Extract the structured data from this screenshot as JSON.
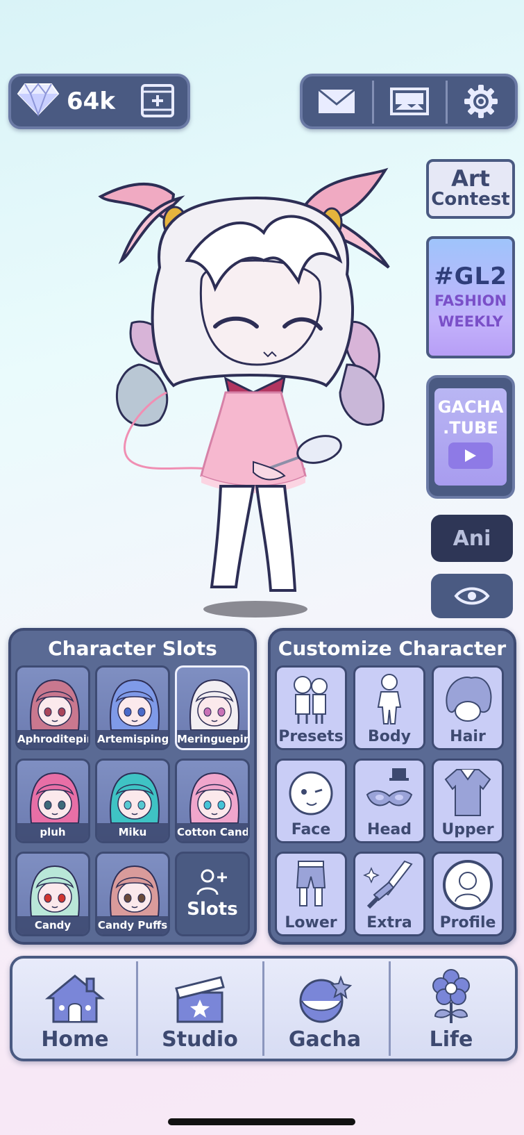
{
  "currency": {
    "amount": "64k"
  },
  "side": {
    "art_contest_line1": "Art",
    "art_contest_line2": "Contest",
    "fashion_line1": "#GL2",
    "fashion_line2": "FASHION",
    "fashion_line3": "WEEKLY",
    "tube_line1": "GACHA",
    "tube_line2": ".TUBE",
    "ani_label": "Ani"
  },
  "slots_panel": {
    "title": "Character Slots",
    "slots": [
      {
        "name": "Aphroditeping",
        "hair": "#c9788f",
        "eyes": "#a9455a"
      },
      {
        "name": "Artemisping",
        "hair": "#7f9ae8",
        "eyes": "#4a6ac9"
      },
      {
        "name": "Meringueping",
        "hair": "#f2eef2",
        "eyes": "#c971b6"
      },
      {
        "name": "pluh",
        "hair": "#e86fa6",
        "eyes": "#3d6a7a"
      },
      {
        "name": "Miku",
        "hair": "#3fc3c4",
        "eyes": "#57c9d1"
      },
      {
        "name": "Cotton Candy",
        "hair": "#f0a6cc",
        "eyes": "#45c3d6"
      },
      {
        "name": "Candy",
        "hair": "#b9e7d8",
        "eyes": "#d0362f"
      },
      {
        "name": "Candy Puffs",
        "hair": "#d99b9b",
        "eyes": "#6a4a3a"
      }
    ],
    "add_label": "Slots"
  },
  "customize_panel": {
    "title": "Customize Character",
    "items": [
      "Presets",
      "Body",
      "Hair",
      "Face",
      "Head",
      "Upper",
      "Lower",
      "Extra",
      "Profile"
    ]
  },
  "nav": {
    "home": "Home",
    "studio": "Studio",
    "gacha": "Gacha",
    "life": "Life"
  }
}
